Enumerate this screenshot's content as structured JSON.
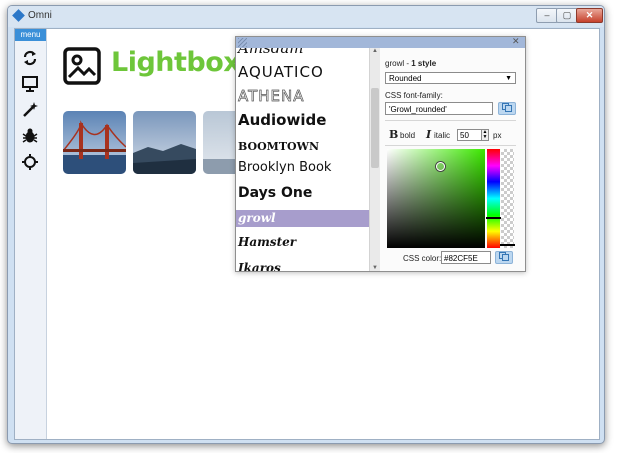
{
  "window": {
    "title": "Omni",
    "min_glyph": "–",
    "max_glyph": "▢",
    "close_glyph": "✕"
  },
  "sidebar": {
    "menu_label": "menu",
    "icons": [
      "refresh-icon",
      "monitor-icon",
      "magic-wand-icon",
      "bug-icon",
      "crosshair-icon"
    ]
  },
  "content": {
    "logo_text": "Lightbox",
    "brand_color": "#6EC63A",
    "thumbnails": [
      "bridge-photo",
      "coast-photo",
      "sky-photo"
    ]
  },
  "font_panel": {
    "close_glyph": "✕",
    "fonts": [
      "Amsdam",
      "AQUATICO",
      "ATHENA",
      "Audiowide",
      "BOOMTOWN",
      "Brooklyn Book",
      "Days One",
      "growl",
      "Hamster",
      "Ikaros"
    ],
    "selected_font": "growl",
    "scroll_up": "▲",
    "scroll_down": "▼",
    "font_name": "growl",
    "style_sep": " - ",
    "style_count": "1 style",
    "style_selected": "Rounded",
    "css_family_label": "CSS font-family:",
    "css_family_value": "'Growl_rounded'",
    "bold_glyph": "B",
    "bold_label": "bold",
    "italic_glyph": "I",
    "italic_label": "italic",
    "size_value": "50",
    "size_unit": "px",
    "css_color_label": "CSS color:",
    "css_color_value": "#82CF5E"
  }
}
